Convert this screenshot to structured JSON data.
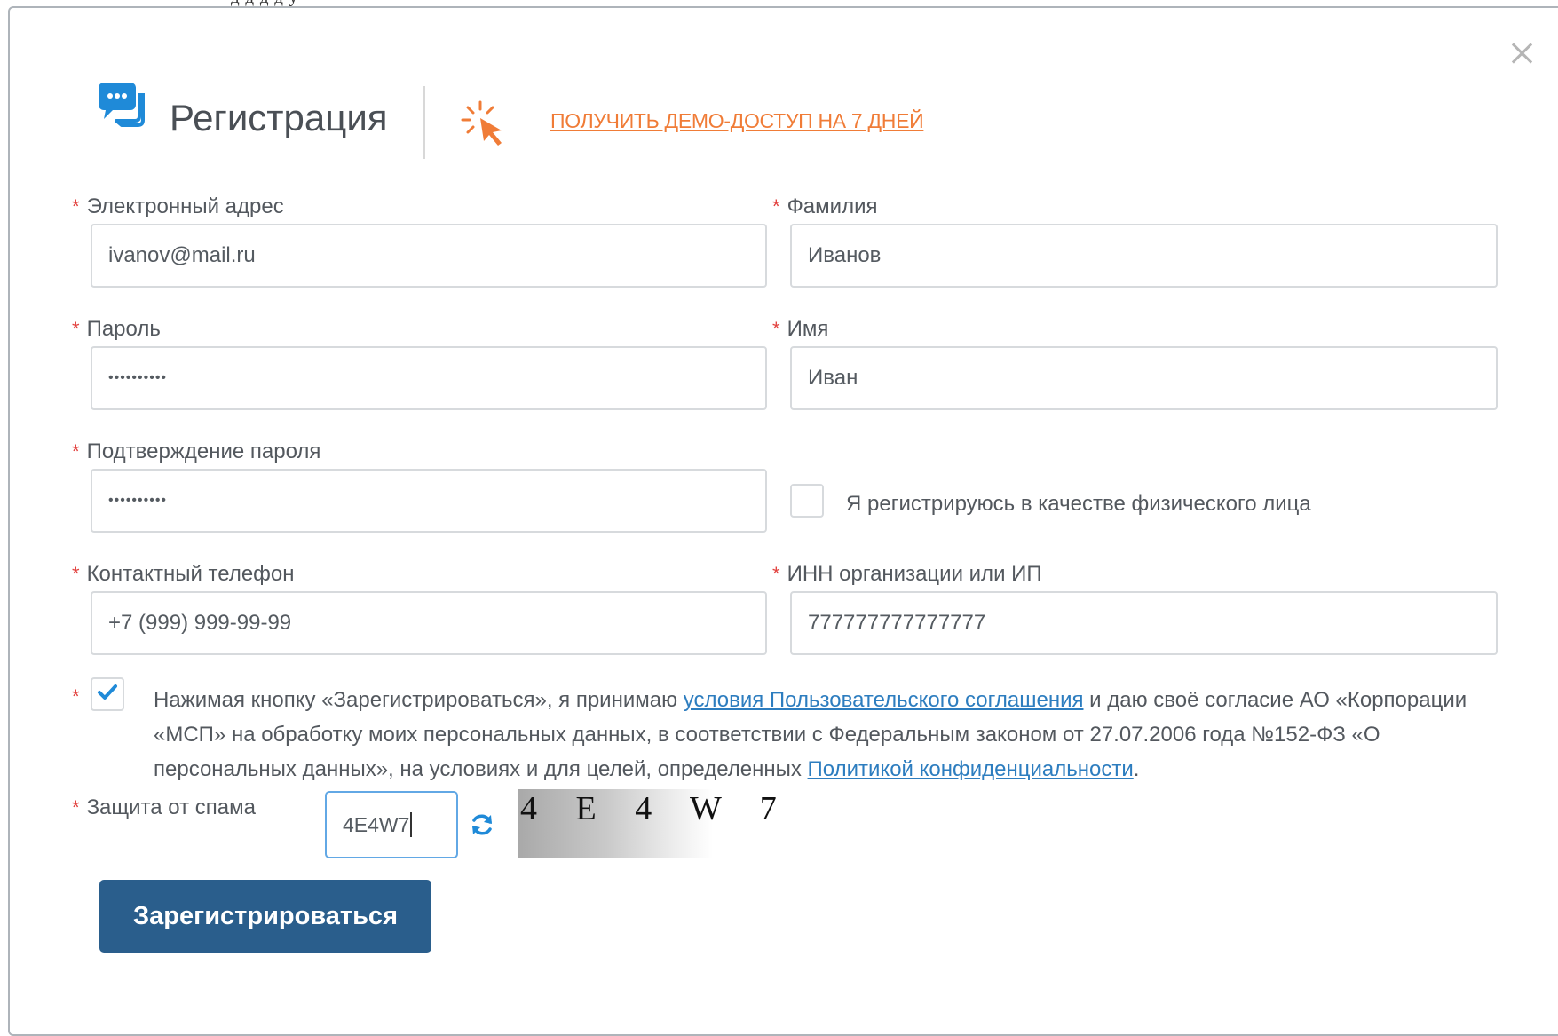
{
  "top_strip_text": "д   д   д        д        у",
  "header": {
    "title": "Регистрация",
    "demo_link": "ПОЛУЧИТЬ ДЕМО-ДОСТУП НА 7 ДНЕЙ"
  },
  "form": {
    "required_mark": "*",
    "email": {
      "label": "Электронный адрес",
      "value": "ivanov@mail.ru"
    },
    "lastname": {
      "label": "Фамилия",
      "value": "Иванов"
    },
    "password": {
      "label": "Пароль",
      "value": "••••••••••"
    },
    "firstname": {
      "label": "Имя",
      "value": "Иван"
    },
    "password_confirm": {
      "label": "Подтверждение пароля",
      "value": "••••••••••"
    },
    "individual": {
      "label": "Я регистрируюсь в качестве физического лица",
      "checked": false
    },
    "phone": {
      "label": "Контактный телефон",
      "value": "+7 (999) 999-99-99"
    },
    "inn": {
      "label": "ИНН организации или ИП",
      "value": "777777777777777"
    },
    "consent": {
      "checked": true,
      "text_1": "Нажимая кнопку «Зарегистрироваться», я принимаю ",
      "link_1": "условия Пользовательского соглашения",
      "text_2": " и даю своё согласие АО «Корпорации «МСП» на обработку моих персональных данных, в соответствии с Федеральным законом от 27.07.2006 года №152-ФЗ «О персональных данных», на условиях и для целей, определенных ",
      "link_2": "Политикой конфиденциальности",
      "text_3": "."
    },
    "captcha": {
      "label": "Защита от спама",
      "value": "4E4W7",
      "image_text": "4 E 4 W 7"
    },
    "submit_label": "Зарегистрироваться"
  },
  "colors": {
    "accent_orange": "#f07c37",
    "button_blue": "#2a5e8c",
    "link_blue": "#2d7dbf",
    "icon_blue": "#1f8ad8",
    "required_red": "#e2403d"
  },
  "icons": [
    "chat-icon",
    "cursor-click-icon",
    "close-icon",
    "refresh-icon",
    "checkmark-icon"
  ]
}
